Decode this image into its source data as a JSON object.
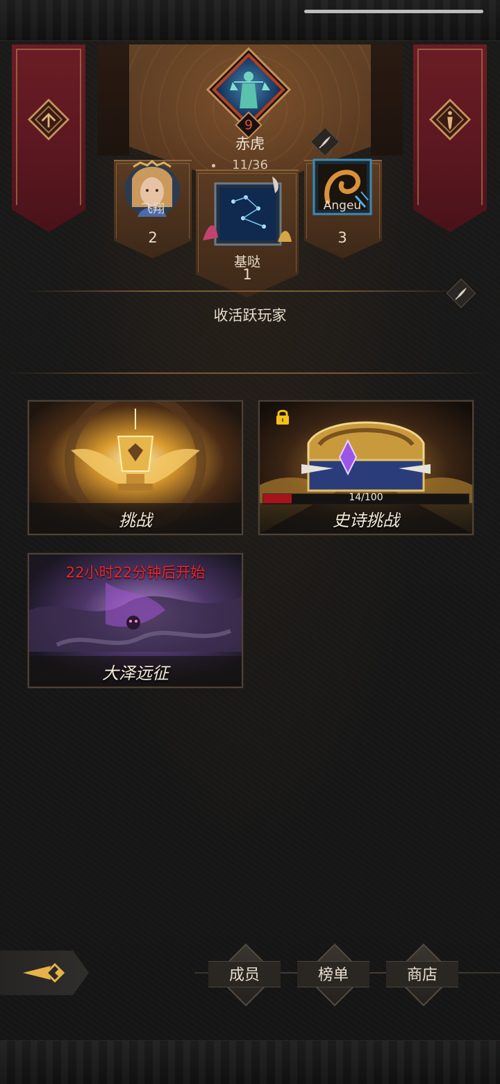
{
  "guild": {
    "level": "9",
    "name": "赤虎",
    "members": "11/36"
  },
  "ranking": [
    {
      "rank": "1",
      "name": "基哒"
    },
    {
      "rank": "2",
      "name": "飞翔"
    },
    {
      "rank": "3",
      "name": "Angeu"
    }
  ],
  "recruit_label": "收活跃玩家",
  "activities": {
    "challenge": {
      "label": "挑战"
    },
    "epic_challenge": {
      "label": "史诗挑战",
      "progress_text": "14/100",
      "progress": 0.14,
      "locked": true
    },
    "expedition": {
      "label": "大泽远征",
      "countdown": "22小时22分钟后开始"
    }
  },
  "bottom_nav": {
    "members": "成员",
    "leaderboard": "榜单",
    "shop": "商店"
  },
  "colors": {
    "banner_red": "#5a1720",
    "gold_accent": "#c49458",
    "countdown_red": "#e6282a",
    "progress_red": "#a5141a"
  },
  "icons": [
    "guild-emblem-icon",
    "rank-up-icon",
    "info-icon",
    "edit-quill-icon",
    "lock-icon",
    "back-arrow-icon"
  ]
}
